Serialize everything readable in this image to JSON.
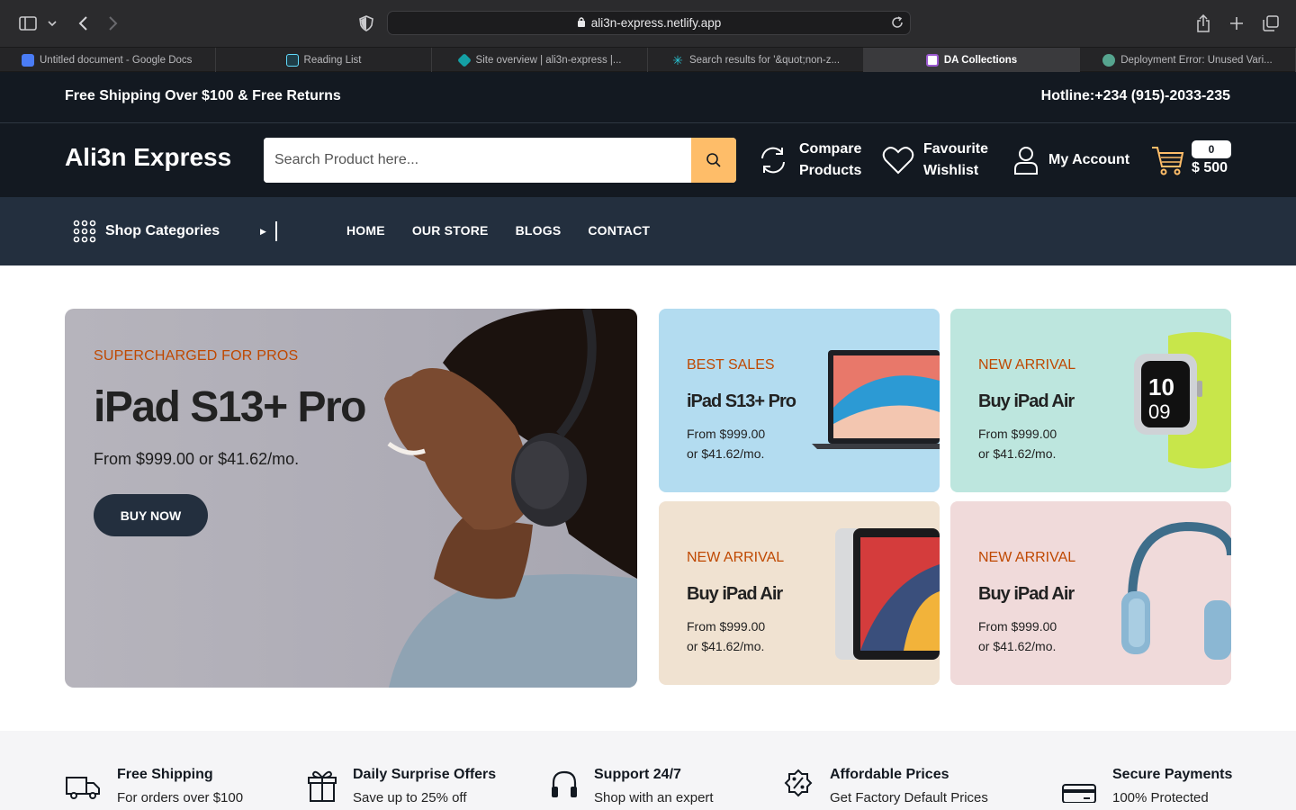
{
  "browser": {
    "url": "ali3n-express.netlify.app",
    "tabs": [
      {
        "label": "Untitled document - Google Docs",
        "color": "#4a7cf5"
      },
      {
        "label": "Reading List",
        "color": "#1f3d47"
      },
      {
        "label": "Site overview | ali3n-express |...",
        "color": "#14a0a5"
      },
      {
        "label": "Search results for '&quot;non-z...",
        "color": "#2ac6d6"
      },
      {
        "label": "DA Collections",
        "color": "#ffffff"
      },
      {
        "label": "Deployment Error: Unused Vari...",
        "color": "#56a58f"
      }
    ],
    "active_tab_index": 4
  },
  "topbar": {
    "promo": "Free Shipping Over $100 & Free Returns",
    "hotline": "Hotline:+234 (915)-2033-235"
  },
  "header": {
    "logo": "Ali3n Express",
    "search_placeholder": "Search Product here...",
    "compare_line1": "Compare",
    "compare_line2": "Products",
    "wishlist_line1": "Favourite",
    "wishlist_line2": "Wishlist",
    "account": "My Account",
    "cart_count": "0",
    "cart_total": "$ 500"
  },
  "nav": {
    "categories_label": "Shop Categories",
    "links": [
      "HOME",
      "OUR STORE",
      "BLOGS",
      "CONTACT"
    ]
  },
  "hero": {
    "eyebrow": "SUPERCHARGED FOR PROS",
    "title": "iPad S13+ Pro",
    "price": "From $999.00 or $41.62/mo.",
    "cta": "BUY NOW"
  },
  "promo_cards": [
    {
      "eyebrow": "BEST SALES",
      "title": "iPad S13+ Pro",
      "price1": "From $999.00",
      "price2": "or $41.62/mo.",
      "bg": "#b3dcf0",
      "product": "laptop"
    },
    {
      "eyebrow": "NEW ARRIVAL",
      "title": "Buy iPad Air",
      "price1": "From $999.00",
      "price2": "or $41.62/mo.",
      "bg": "#bde6de",
      "product": "smartwatch"
    },
    {
      "eyebrow": "NEW ARRIVAL",
      "title": "Buy iPad Air",
      "price1": "From $999.00",
      "price2": "or $41.62/mo.",
      "bg": "#f0e2d1",
      "product": "tablet"
    },
    {
      "eyebrow": "NEW ARRIVAL",
      "title": "Buy iPad Air",
      "price1": "From $999.00",
      "price2": "or $41.62/mo.",
      "bg": "#f0dada",
      "product": "headphones"
    }
  ],
  "services": [
    {
      "title": "Free Shipping",
      "subtitle": "For orders over $100",
      "icon": "truck-icon"
    },
    {
      "title": "Daily Surprise Offers",
      "subtitle": "Save up to 25% off",
      "icon": "gift-icon"
    },
    {
      "title": "Support 24/7",
      "subtitle": "Shop with an expert",
      "icon": "headset-icon"
    },
    {
      "title": "Affordable Prices",
      "subtitle": "Get Factory Default Prices",
      "icon": "discount-badge-icon"
    },
    {
      "title": "Secure Payments",
      "subtitle": "100% Protected",
      "icon": "credit-card-icon"
    }
  ],
  "colors": {
    "dark": "#131921",
    "nav": "#232f3e",
    "accent": "#febd69",
    "eyebrow": "#bf4800"
  }
}
